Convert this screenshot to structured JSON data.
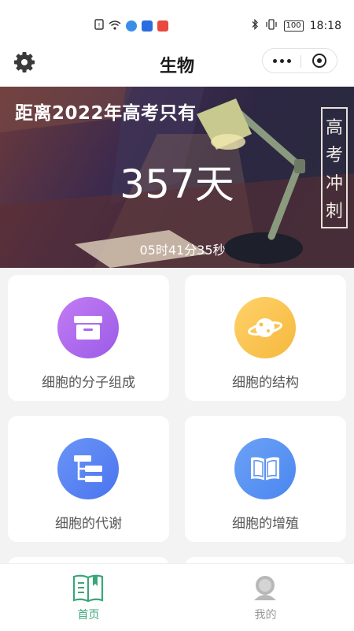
{
  "status_bar": {
    "time": "18:18",
    "battery": "100",
    "left_icons": [
      "sim-icon",
      "wifi-icon",
      "globe-icon",
      "tips-icon",
      "app-icon"
    ]
  },
  "nav": {
    "title": "生物",
    "left_icon": "gear-icon",
    "capsule_icons": [
      "more-icon",
      "close-circle-icon"
    ]
  },
  "banner": {
    "countdown_title": "距离2022年高考只有",
    "days": "357天",
    "time_remaining": "05时41分35秒",
    "vertical_chars": [
      "高",
      "考",
      "冲",
      "刺"
    ]
  },
  "cards": [
    {
      "label": "细胞的分子组成",
      "icon": "box-icon",
      "color_from": "#c27cf3",
      "color_to": "#9b5be8"
    },
    {
      "label": "细胞的结构",
      "icon": "planet-icon",
      "color_from": "#ffd26a",
      "color_to": "#f5b83d"
    },
    {
      "label": "细胞的代谢",
      "icon": "tree-structure-icon",
      "color_from": "#6a95f8",
      "color_to": "#4a74ee"
    },
    {
      "label": "细胞的增殖",
      "icon": "book-open-icon",
      "color_from": "#6ba2f6",
      "color_to": "#4b86f0"
    }
  ],
  "tabbar": {
    "active_color": "#3aa67a",
    "inactive_color": "#999999",
    "tabs": [
      {
        "label": "首页",
        "icon": "home-book-icon",
        "active": true
      },
      {
        "label": "我的",
        "icon": "user-icon",
        "active": false
      }
    ]
  }
}
